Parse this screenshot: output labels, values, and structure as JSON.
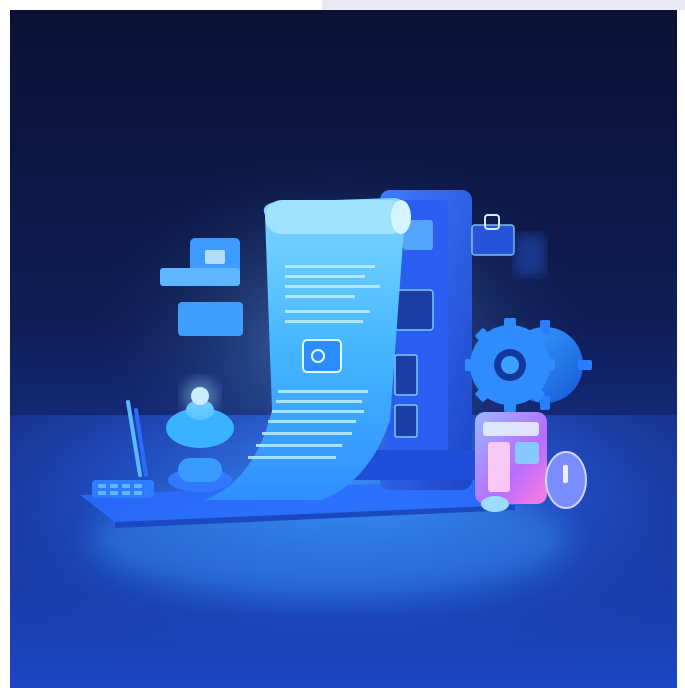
{
  "image": {
    "kind": "3d-illustration",
    "subject-icons": [
      "document-scroll-icon",
      "tablet-device-icon",
      "gear-icon",
      "chat-widget-icon",
      "clipboard-icon",
      "pen-holder-icon",
      "lightbulb-lamp-icon",
      "keyboard-icon",
      "server-box-icon",
      "clock-coin-icon"
    ],
    "colors": {
      "background_top": "#0a1133",
      "background_mid": "#142a7a",
      "floor": "#1d4fd4",
      "glow": "#5fd2ff",
      "paper": "#4cc3ff",
      "accent_pink": "#e46cff"
    }
  }
}
